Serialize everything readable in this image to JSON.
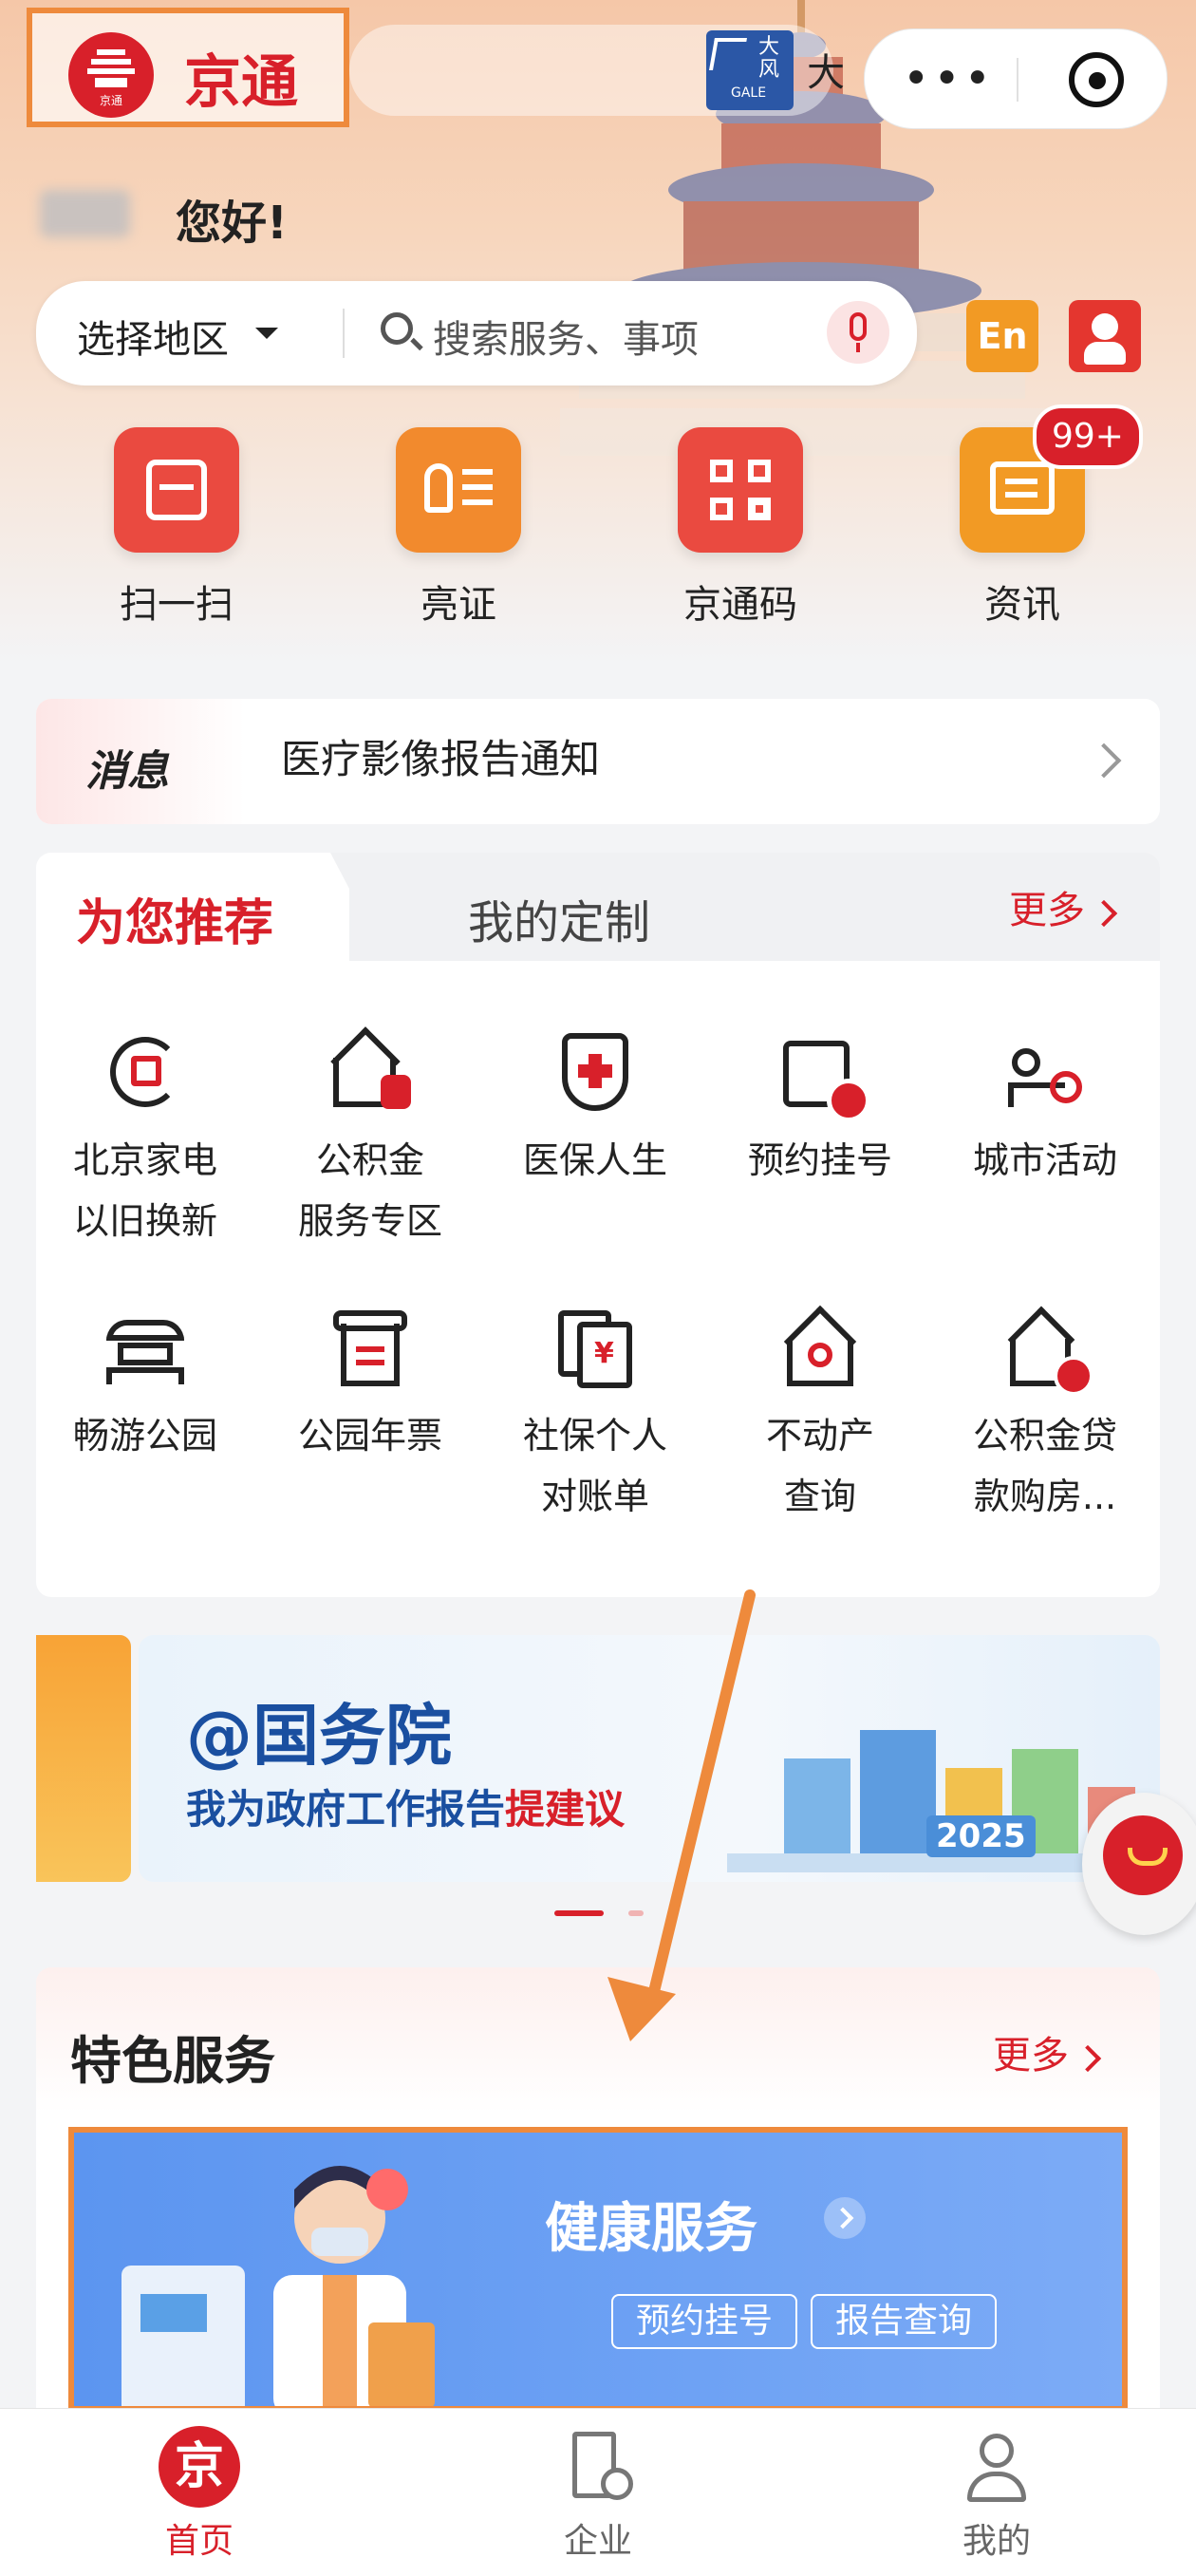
{
  "app": {
    "title": "京通",
    "logo_sub": "京通"
  },
  "header": {
    "weather_badge_top": "大风",
    "weather_badge_bottom": "GALE",
    "weather_text": "大",
    "greeting": "您好!"
  },
  "search": {
    "region": "选择地区",
    "placeholder": "搜索服务、事项",
    "en_label": "En"
  },
  "quick_actions": [
    {
      "label": "扫一扫",
      "icon": "scan-icon"
    },
    {
      "label": "亮证",
      "icon": "id-card-icon"
    },
    {
      "label": "京通码",
      "icon": "qr-code-icon"
    },
    {
      "label": "资讯",
      "icon": "news-icon",
      "badge": "99+"
    }
  ],
  "message": {
    "tag": "消息",
    "text": "医疗影像报告通知"
  },
  "recommend": {
    "tab_active": "为您推荐",
    "tab_inactive": "我的定制",
    "more": "更多",
    "services": [
      {
        "line1": "北京家电",
        "line2": "以旧换新",
        "icon": "appliance-trade-in-icon"
      },
      {
        "line1": "公积金",
        "line2": "服务专区",
        "icon": "housing-fund-icon"
      },
      {
        "line1": "医保人生",
        "line2": "",
        "icon": "medical-insurance-icon"
      },
      {
        "line1": "预约挂号",
        "line2": "",
        "icon": "appointment-icon"
      },
      {
        "line1": "城市活动",
        "line2": "",
        "icon": "city-activity-icon"
      },
      {
        "line1": "畅游公园",
        "line2": "",
        "icon": "park-tour-icon"
      },
      {
        "line1": "公园年票",
        "line2": "",
        "icon": "park-ticket-icon"
      },
      {
        "line1": "社保个人",
        "line2": "对账单",
        "icon": "social-security-icon"
      },
      {
        "line1": "不动产",
        "line2": "查询",
        "icon": "real-estate-icon"
      },
      {
        "line1": "公积金贷",
        "line2": "款购房...",
        "icon": "fund-loan-icon"
      }
    ]
  },
  "banner": {
    "title": "@国务院",
    "sub_prefix": "我为政府工作报告",
    "sub_highlight": "提建议",
    "year": "2025"
  },
  "featured": {
    "title": "特色服务",
    "more": "更多",
    "health": {
      "title": "健康服务",
      "pill1": "预约挂号",
      "pill2": "报告查询"
    }
  },
  "tabbar": [
    {
      "label": "首页",
      "icon_text": "京",
      "active": true
    },
    {
      "label": "企业",
      "active": false
    },
    {
      "label": "我的",
      "active": false
    }
  ],
  "colors": {
    "accent": "#d8202a",
    "highlight": "#ee8a3c",
    "orange": "#f29a24"
  }
}
